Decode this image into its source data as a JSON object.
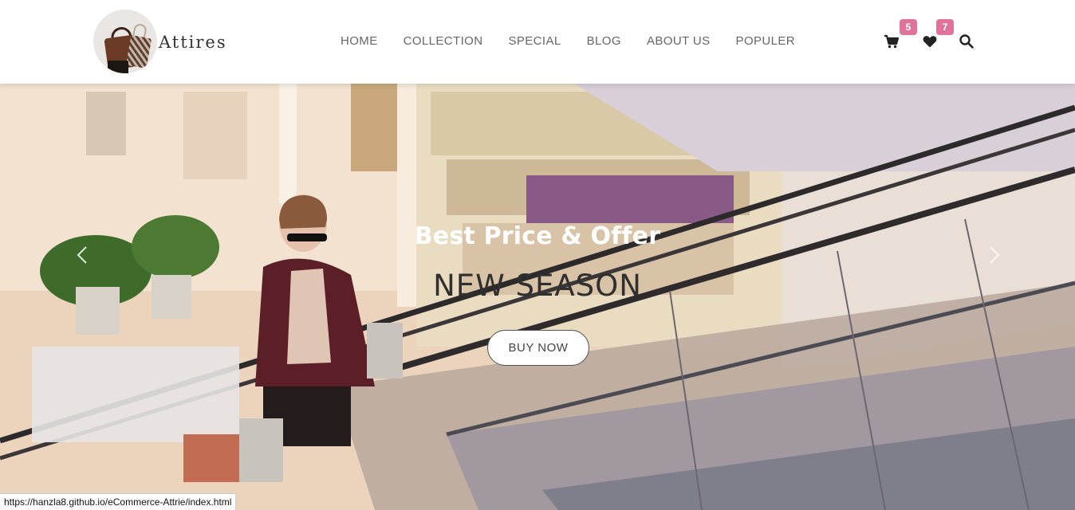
{
  "brand": {
    "name": "Attires"
  },
  "nav": {
    "items": [
      {
        "label": "HOME"
      },
      {
        "label": "COLLECTION"
      },
      {
        "label": "SPECIAL"
      },
      {
        "label": "BLOG"
      },
      {
        "label": "ABOUT US"
      },
      {
        "label": "POPULER"
      }
    ]
  },
  "icons": {
    "cart": {
      "icon": "cart-icon",
      "count": "5"
    },
    "wishlist": {
      "icon": "heart-icon",
      "count": "7"
    },
    "search": {
      "icon": "search-icon"
    }
  },
  "hero": {
    "subtitle": "Best Price & Offer",
    "title": "NEW SEASON",
    "button_label": "BUY NOW",
    "prev_icon": "chevron-left-icon",
    "next_icon": "chevron-right-icon"
  },
  "status_bar": {
    "url": "https://hanzla8.github.io/eCommerce-Attrie/index.html"
  },
  "colors": {
    "badge": "#e0739a",
    "nav_text": "#666666",
    "hero_subtitle": "#ffffff",
    "hero_title": "#303030"
  }
}
